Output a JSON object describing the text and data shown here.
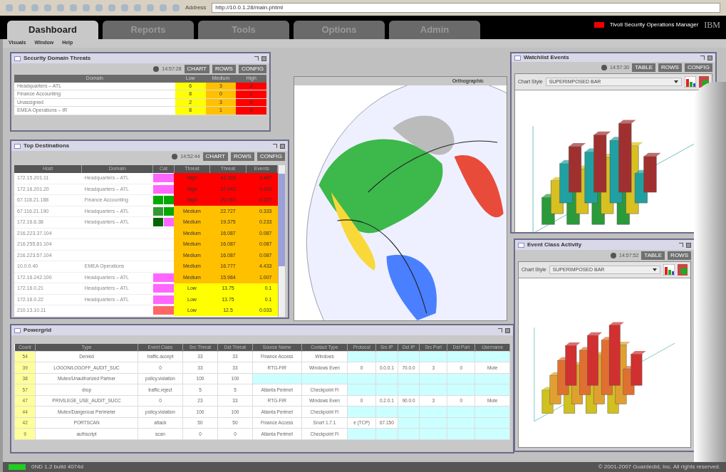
{
  "browser": {
    "address_label": "Address",
    "url": "http://10.0.1.28/main.phtml"
  },
  "brand": {
    "product": "Tivoli Security Operations Manager",
    "logo": "IBM"
  },
  "tabs": [
    {
      "label": "Dashboard",
      "selected": true
    },
    {
      "label": "Reports",
      "selected": false
    },
    {
      "label": "Tools",
      "selected": false
    },
    {
      "label": "Options",
      "selected": false
    },
    {
      "label": "Admin",
      "selected": false
    }
  ],
  "menu": [
    "Visuals",
    "Window",
    "Help"
  ],
  "domain_threats": {
    "title": "Security Domain Threats",
    "time": "14:57:28",
    "buttons": [
      "CHART",
      "ROWS",
      "CONFIG"
    ],
    "columns": [
      "Domain",
      "Low",
      "Medium",
      "High"
    ],
    "rows": [
      [
        "Headquarters – ATL",
        "6",
        "3",
        "2"
      ],
      [
        "Finance Accounting",
        "8",
        "0",
        "1"
      ],
      [
        "Unassigned",
        "2",
        "3",
        "0"
      ],
      [
        "EMEA Operations – IR",
        "8",
        "1",
        "0"
      ]
    ]
  },
  "top_destinations": {
    "title": "Top Destinations",
    "time": "14:52:44",
    "buttons": [
      "CHART",
      "ROWS",
      "CONFIG"
    ],
    "columns": [
      "Host",
      "Domain",
      "Cat",
      "Threat",
      "Threat",
      "Events"
    ],
    "rows": [
      {
        "host": "172.15.201.11",
        "domain": "Headquarters – ATL",
        "cat": [
          {
            "color": "#ff66ff"
          }
        ],
        "level": "High",
        "threat": "42.183",
        "events": "1.487"
      },
      {
        "host": "172.16.201.20",
        "domain": "Headquarters – ATL",
        "cat": [
          {
            "color": "#ff66ff"
          }
        ],
        "level": "High",
        "threat": "37.443",
        "events": "1.433"
      },
      {
        "host": "67.118.21.188",
        "domain": "Finance Accounting",
        "cat": [
          {
            "color": "#00aa00"
          },
          {
            "color": "#00aa00"
          }
        ],
        "level": "High",
        "threat": "20.167",
        "events": "0.167"
      },
      {
        "host": "67.116.21.190",
        "domain": "Headquarters – ATL",
        "cat": [
          {
            "color": "#339933"
          },
          {
            "color": "#00aa00"
          }
        ],
        "level": "Medium",
        "threat": "22.727",
        "events": "0.333"
      },
      {
        "host": "172.16.6.38",
        "domain": "Headquarters – ATL",
        "cat": [
          {
            "color": "#006600"
          },
          {
            "color": "#ff66ff"
          }
        ],
        "level": "Medium",
        "threat": "19.375",
        "events": "0.233"
      },
      {
        "host": "216.223.37.104",
        "domain": "",
        "cat": [],
        "level": "Medium",
        "threat": "16.087",
        "events": "0.087"
      },
      {
        "host": "216.255.81.104",
        "domain": "",
        "cat": [],
        "level": "Medium",
        "threat": "16.087",
        "events": "0.087"
      },
      {
        "host": "216.223.57.104",
        "domain": "",
        "cat": [],
        "level": "Medium",
        "threat": "16.087",
        "events": "0.087"
      },
      {
        "host": "10.0.0.40",
        "domain": "EMEA Operations",
        "cat": [],
        "level": "Medium",
        "threat": "16.777",
        "events": "4.433"
      },
      {
        "host": "172.16.242.100",
        "domain": "Headquarters – ATL",
        "cat": [
          {
            "color": "#ff66ff"
          }
        ],
        "level": "Medium",
        "threat": "15.984",
        "events": "1.007"
      },
      {
        "host": "172.16.0.21",
        "domain": "Headquarters – ATL",
        "cat": [
          {
            "color": "#ff66ff"
          }
        ],
        "level": "Low",
        "threat": "13.75",
        "events": "0.1"
      },
      {
        "host": "172.16.0.22",
        "domain": "Headquarters – ATL",
        "cat": [
          {
            "color": "#ff66ff"
          }
        ],
        "level": "Low",
        "threat": "13.75",
        "events": "0.1"
      },
      {
        "host": "210.13.10.11",
        "domain": "",
        "cat": [
          {
            "color": "#ff6666"
          }
        ],
        "level": "Low",
        "threat": "12.5",
        "events": "0.033"
      }
    ]
  },
  "map": {
    "projection": "Orthographic"
  },
  "watchlist": {
    "title": "Watchlist Events",
    "time": "14:57:30",
    "buttons": [
      "TABLE",
      "ROWS",
      "CONFIG"
    ],
    "chart_style_label": "Chart Style",
    "chart_style": "SUPERIMPOSED BAR"
  },
  "event_class": {
    "title": "Event Class Activity",
    "time": "14:57:52",
    "buttons": [
      "TABLE",
      "ROWS"
    ],
    "chart_style_label": "Chart Style",
    "chart_style": "SUPERIMPOSED BAR"
  },
  "grid": {
    "title": "Powergrid",
    "columns": [
      "Count",
      "Type",
      "Event Class",
      "Src Threat",
      "Dst Threat",
      "Source Name",
      "Contact Type",
      "Protocol",
      "Src IP",
      "Dst IP",
      "Src Port",
      "Dst Port",
      "Username"
    ],
    "rows": [
      [
        "54",
        "Denied",
        "traffic.accept",
        "33",
        "33",
        "Finance Access",
        "Windows",
        "",
        "",
        "",
        "",
        "",
        ""
      ],
      [
        "39",
        "LOGON/LOGOFF_AUDIT_SUC",
        "0",
        "33",
        "33",
        "RTG-FIR",
        "Windows Even",
        "0",
        "0.0.0.1",
        "70.0.0",
        "3",
        "0",
        "Mute"
      ],
      [
        "38",
        "Mutex/Unauthorized Partner",
        "policy.violation",
        "100",
        "100",
        "",
        "",
        "",
        "",
        "",
        "",
        "",
        ""
      ],
      [
        "57",
        "drop",
        "traffic.reject",
        "5",
        "5",
        "Atlanta Perimet",
        "Checkpoint Fi",
        "",
        "",
        "",
        "",
        "",
        ""
      ],
      [
        "47",
        "PRIVILEGE_USE_AUDIT_SUCC",
        "0",
        "23",
        "33",
        "RTG-FIR",
        "Windows Even",
        "0",
        "0.2.0.1",
        "90.0.0",
        "3",
        "0",
        "Mute"
      ],
      [
        "44",
        "Mutex/Dangerous Perimeter",
        "policy.violation",
        "100",
        "100",
        "Atlanta Perimet",
        "Checkpoint Fi",
        "",
        "",
        "",
        "",
        "",
        ""
      ],
      [
        "42",
        "PORTSCAN",
        "attack",
        "50",
        "50",
        "Finance Access",
        "Snort 1.7.1",
        "e (TCP)",
        "67.150",
        "",
        "",
        "",
        ""
      ],
      [
        "9",
        "authscript",
        "scan",
        "0",
        "0",
        "Atlanta Perimet",
        "Checkpoint Fi",
        "",
        "",
        "",
        "",
        "",
        ""
      ]
    ]
  },
  "status": {
    "left": "0ND 1.2 build 4074d",
    "right": "© 2001-2007 Guardedid, Inc. All rights reserved."
  }
}
